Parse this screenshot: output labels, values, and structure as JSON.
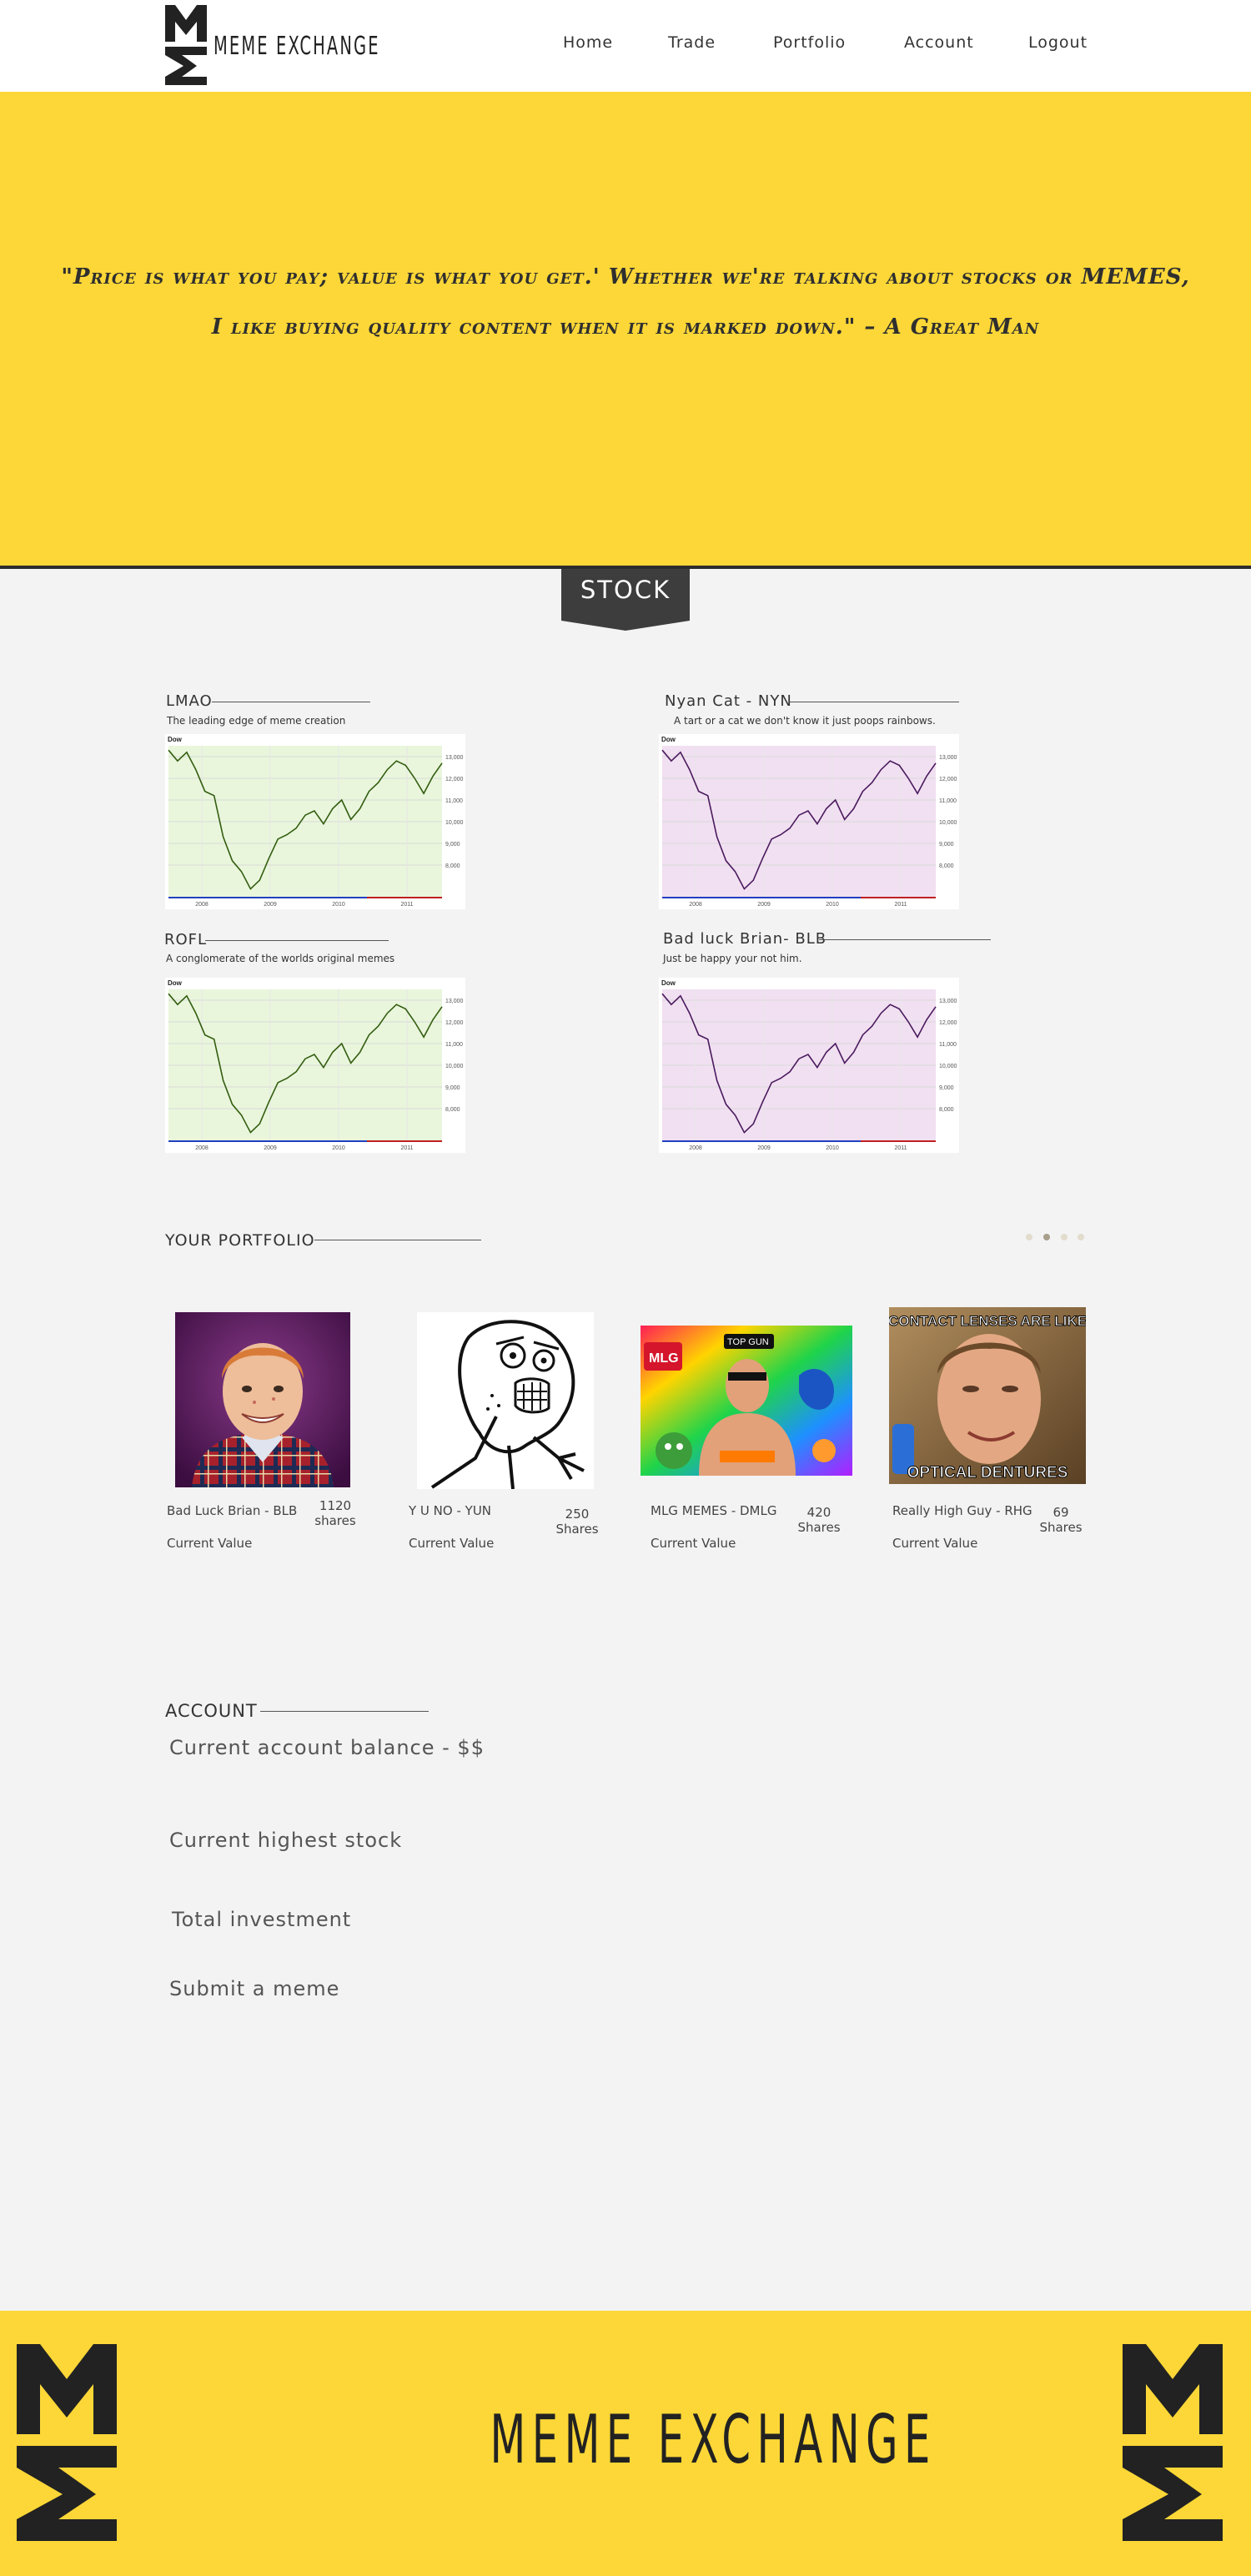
{
  "header": {
    "brand": "MEME EXCHANGE",
    "nav": [
      "Home",
      "Trade",
      "Portfolio",
      "Account",
      "Logout"
    ]
  },
  "hero": {
    "quote_line1": "\"Price is what you pay; value is what you get.' Whether we're talking about stocks or MEMES,",
    "quote_line2": "I like buying quality content when it is marked down.\" – A Great Man"
  },
  "stock": {
    "tab_label": "STOCK",
    "cards": [
      {
        "title": "LMAO",
        "subtitle": "The leading edge of meme creation",
        "chart_label": "Dow"
      },
      {
        "title": "Nyan Cat - NYN",
        "subtitle": "A tart or a cat we don't know it just poops rainbows.",
        "chart_label": "Dow"
      },
      {
        "title": "ROFL",
        "subtitle": "A conglomerate of the worlds original memes",
        "chart_label": "Dow"
      },
      {
        "title": "Bad luck Brian- BLB",
        "subtitle": "Just be happy your not him.",
        "chart_label": "Dow"
      }
    ]
  },
  "chart_data": [
    {
      "type": "area",
      "title": "Dow",
      "x_ticks": [
        "2008",
        "2009",
        "2010",
        "2011"
      ],
      "y_ticks": [
        "8,000",
        "9,000",
        "10,000",
        "11,000",
        "12,000",
        "13,000"
      ],
      "ylim": [
        6500,
        13500
      ],
      "values": [
        13300,
        12800,
        13200,
        12400,
        11400,
        11200,
        9300,
        8200,
        7700,
        6900,
        7300,
        8300,
        9200,
        9400,
        9700,
        10300,
        10500,
        9900,
        10600,
        11000,
        10100,
        10600,
        11400,
        11800,
        12400,
        12800,
        12600,
        12000,
        11300,
        12100,
        12700
      ],
      "colors": {
        "line": "#335d10",
        "fill": "#e9f6dc"
      }
    },
    {
      "type": "area",
      "title": "Dow",
      "x_ticks": [
        "2008",
        "2009",
        "2010",
        "2011"
      ],
      "y_ticks": [
        "8,000",
        "9,000",
        "10,000",
        "11,000",
        "12,000",
        "13,000"
      ],
      "ylim": [
        6500,
        13500
      ],
      "values": [
        13300,
        12800,
        13200,
        12400,
        11400,
        11200,
        9300,
        8200,
        7700,
        6900,
        7300,
        8300,
        9200,
        9400,
        9700,
        10300,
        10500,
        9900,
        10600,
        11000,
        10100,
        10600,
        11400,
        11800,
        12400,
        12800,
        12600,
        12000,
        11300,
        12100,
        12700
      ],
      "colors": {
        "line": "#4a1a5e",
        "fill": "#f1e0f1"
      }
    }
  ],
  "portfolio": {
    "title": "YOUR PORTFOLIO",
    "items": [
      {
        "name": "Bad Luck Brian  - BLB",
        "shares": "1120",
        "shares_label": "shares",
        "value_label": "Current Value",
        "image": "bad-luck-brian"
      },
      {
        "name": "Y U NO - YUN",
        "shares": "250",
        "shares_label": "Shares",
        "value_label": "Current Value",
        "image": "y-u-no-face"
      },
      {
        "name": "MLG MEMES - DMLG",
        "shares": "420",
        "shares_label": "Shares",
        "value_label": "Current Value",
        "image": "mlg-collage"
      },
      {
        "name": "Really High Guy - RHG",
        "shares": "69",
        "shares_label": "Shares",
        "value_label": "Current Value",
        "image": "really-high-guy",
        "image_top": "CONTACT LENSES ARE LIKE",
        "image_bottom": "OPTICAL DENTURES"
      }
    ],
    "mlg_text": "MLG",
    "mlg_text2": "TOP GUN"
  },
  "account": {
    "title": "ACCOUNT",
    "rows": [
      "Current account balance - $$",
      "Current highest stock",
      "Total investment",
      "Submit a meme"
    ]
  },
  "footer": {
    "brand": "MEME EXCHANGE"
  },
  "colors": {
    "brand_yellow": "#fcd737",
    "dark": "#2c2c2c",
    "tab": "#3d3d3d"
  }
}
